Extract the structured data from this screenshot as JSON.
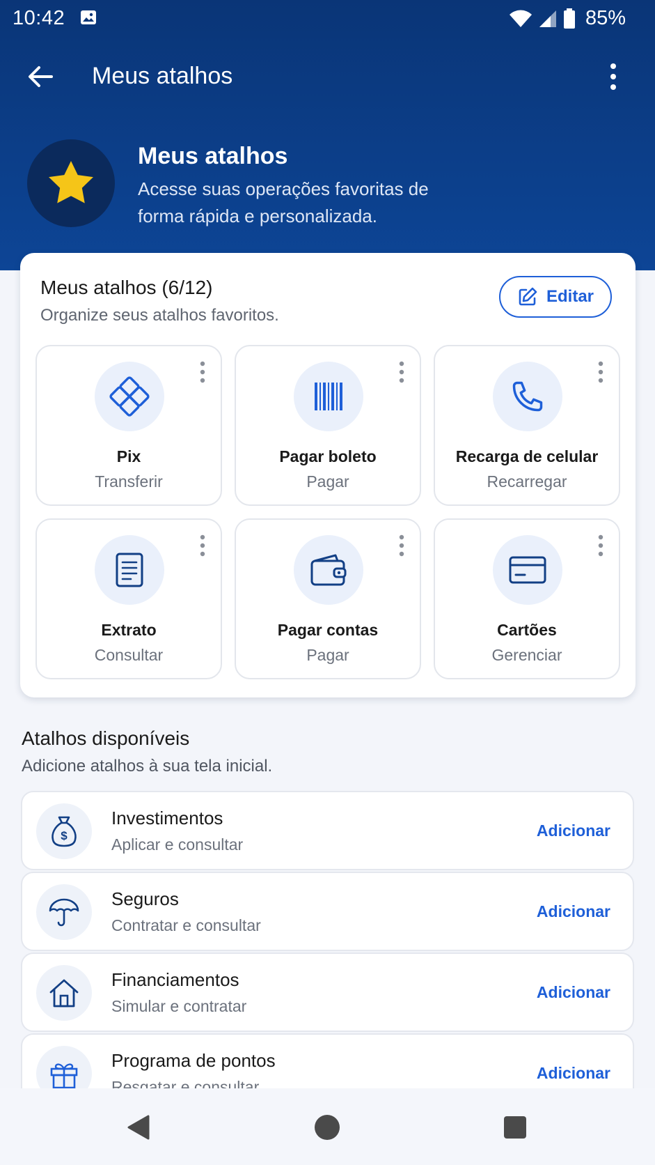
{
  "status_bar": {
    "time": "10:42",
    "battery": "85%"
  },
  "app_bar": {
    "title": "Meus atalhos"
  },
  "hero": {
    "title": "Meus atalhos",
    "subtitle": "Acesse suas operações favoritas de forma rápida e personalizada."
  },
  "shortcuts_card": {
    "title": "Meus atalhos (6/12)",
    "subtitle": "Organize seus atalhos favoritos.",
    "edit_label": "Editar",
    "tiles": [
      {
        "label": "Pix",
        "sub": "Transferir",
        "icon": "pix-icon"
      },
      {
        "label": "Pagar boleto",
        "sub": "Pagar",
        "icon": "barcode-icon"
      },
      {
        "label": "Recarga de celular",
        "sub": "Recarregar",
        "icon": "phone-icon"
      },
      {
        "label": "Extrato",
        "sub": "Consultar",
        "icon": "document-icon"
      },
      {
        "label": "Pagar contas",
        "sub": "Pagar",
        "icon": "wallet-icon"
      },
      {
        "label": "Cartões",
        "sub": "Gerenciar",
        "icon": "credit-card-icon"
      }
    ]
  },
  "available": {
    "title": "Atalhos disponíveis",
    "subtitle": "Adicione atalhos à sua tela inicial.",
    "items": [
      {
        "title": "Investimentos",
        "sub": "Aplicar e consultar",
        "action": "Adicionar",
        "icon": "money-bag-icon"
      },
      {
        "title": "Seguros",
        "sub": "Contratar e consultar",
        "action": "Adicionar",
        "icon": "umbrella-icon"
      },
      {
        "title": "Financiamentos",
        "sub": "Simular e contratar",
        "action": "Adicionar",
        "icon": "house-icon"
      },
      {
        "title": "Programa de pontos",
        "sub": "Resgatar e consultar",
        "action": "Adicionar",
        "icon": "gift-icon"
      }
    ]
  },
  "colors": {
    "header": "#0a3577",
    "accent": "#1e5fd8",
    "star": "#f5c518"
  }
}
